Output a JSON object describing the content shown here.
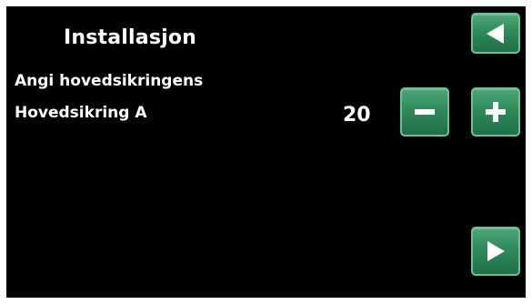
{
  "header": {
    "title": "Installasjon",
    "back_icon": "triangle-left-icon"
  },
  "content": {
    "subtitle": "Angi hovedsikringens",
    "parameter": {
      "label": "Hovedsikring A",
      "value": "20"
    }
  },
  "controls": {
    "decrement_icon": "minus-icon",
    "increment_icon": "plus-icon",
    "next_icon": "triangle-right-icon"
  },
  "colors": {
    "background": "#000000",
    "button_green": "#2f8a5b",
    "button_border": "#6fbf93",
    "text": "#ffffff"
  }
}
